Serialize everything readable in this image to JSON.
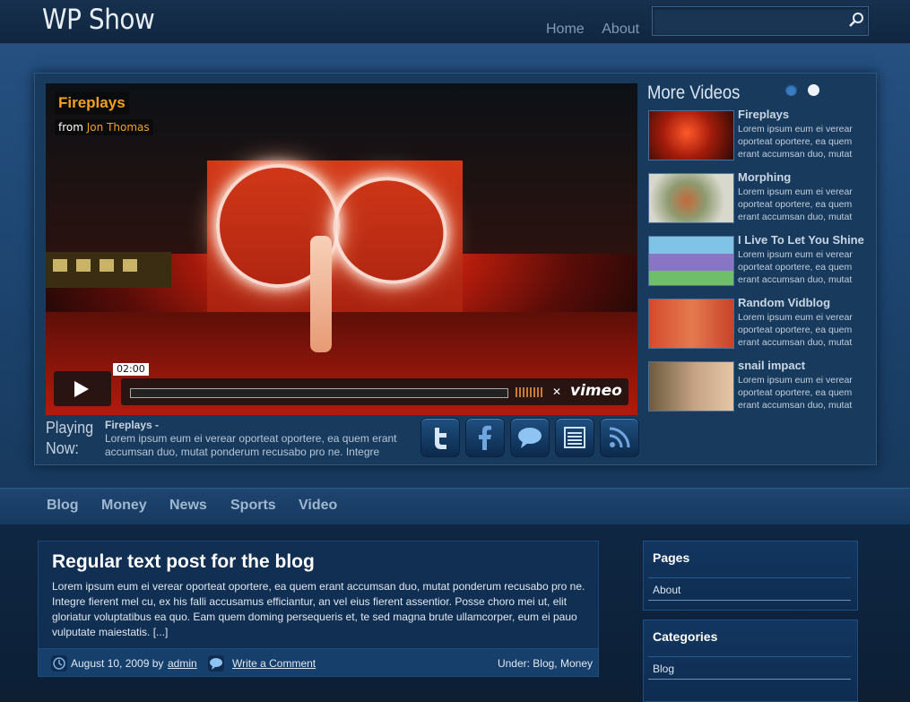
{
  "header": {
    "logo": "WP Show",
    "nav": [
      "Home",
      "About"
    ],
    "search_value": ""
  },
  "featured": {
    "title": "Fireplays",
    "from_label": "from",
    "author": "Jon Thomas",
    "time": "02:00",
    "player_brand": "vimeo",
    "playing_now_label_1": "Playing",
    "playing_now_label_2": "Now:",
    "playing_title": "Fireplays -",
    "playing_desc": "Lorem ipsum eum ei verear oporteat oportere, ea quem erant accumsan duo, mutat ponderum recusabo pro ne. Integre"
  },
  "more_videos": {
    "heading": "More Videos",
    "items": [
      {
        "title": "Fireplays",
        "desc": "Lorem ipsum eum ei verear oporteat oportere, ea quem erant accumsan duo, mutat"
      },
      {
        "title": "Morphing",
        "desc": "Lorem ipsum eum ei verear oporteat oportere, ea quem erant accumsan duo, mutat"
      },
      {
        "title": "I Live To Let You Shine",
        "desc": "Lorem ipsum eum ei verear oporteat oportere, ea quem erant accumsan duo, mutat"
      },
      {
        "title": "Random Vidblog",
        "desc": "Lorem ipsum eum ei verear oporteat oportere, ea quem erant accumsan duo, mutat"
      },
      {
        "title": "snail impact",
        "desc": "Lorem ipsum eum ei verear oporteat oportere, ea quem erant accumsan duo, mutat"
      }
    ]
  },
  "social_icons": [
    "twitter-icon",
    "facebook-icon",
    "comment-icon",
    "list-icon",
    "rss-icon"
  ],
  "category_nav": [
    "Blog",
    "Money",
    "News",
    "Sports",
    "Video"
  ],
  "post": {
    "title": "Regular text post for the blog",
    "body": "Lorem ipsum eum ei verear oporteat oportere, ea quem erant accumsan duo, mutat ponderum recusabo pro ne. Integre fierent mel cu, ex his falli accusamus efficiantur, an vel eius fierent assentior. Posse choro mei ut, elit gloriatur voluptatibus ea quo. Eam quem doming persequeris et, te sed magna brute ullamcorper, eum ei pauo vulputate maiestatis. [...]",
    "date": "August 10, 2009 by",
    "author": "admin",
    "comment_link": "Write a Comment",
    "under": "Under: Blog, Money"
  },
  "sidebar": {
    "pages_title": "Pages",
    "pages": [
      "About"
    ],
    "categories_title": "Categories",
    "categories": [
      "Blog"
    ]
  },
  "colors": {
    "accent_orange": "#f5a021",
    "band_blue": "#1d4570",
    "post_bg": "#102f52"
  }
}
